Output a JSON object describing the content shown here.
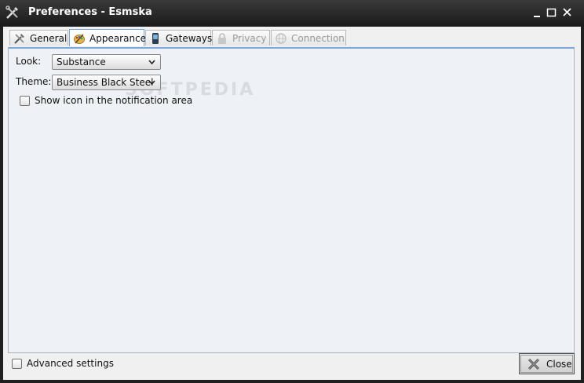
{
  "window": {
    "title": "Preferences - Esmska",
    "app_icon": "tools-icon",
    "controls": [
      "minimize-icon",
      "maximize-icon",
      "close-icon"
    ]
  },
  "tabs": [
    {
      "label": "General",
      "icon": "tools-icon",
      "state": "normal"
    },
    {
      "label": "Appearance",
      "icon": "palette-icon",
      "state": "selected"
    },
    {
      "label": "Gateways",
      "icon": "phone-icon",
      "state": "normal"
    },
    {
      "label": "Privacy",
      "icon": "lock-icon",
      "state": "disabled"
    },
    {
      "label": "Connection",
      "icon": "globe-icon",
      "state": "disabled"
    }
  ],
  "appearance": {
    "look_label": "Look:",
    "look_value": "Substance",
    "theme_label": "Theme:",
    "theme_value": "Business Black Steel",
    "notification_label": "Show icon in the notification area",
    "notification_checked": false
  },
  "watermark": "SOFTPEDIA",
  "footer": {
    "advanced_label": "Advanced settings",
    "advanced_checked": false,
    "close_label": "Close"
  },
  "colors": {
    "titlebar": "#1b1b1b",
    "panel": "#eef2f7",
    "tab_active_border": "#7aa6d9"
  }
}
